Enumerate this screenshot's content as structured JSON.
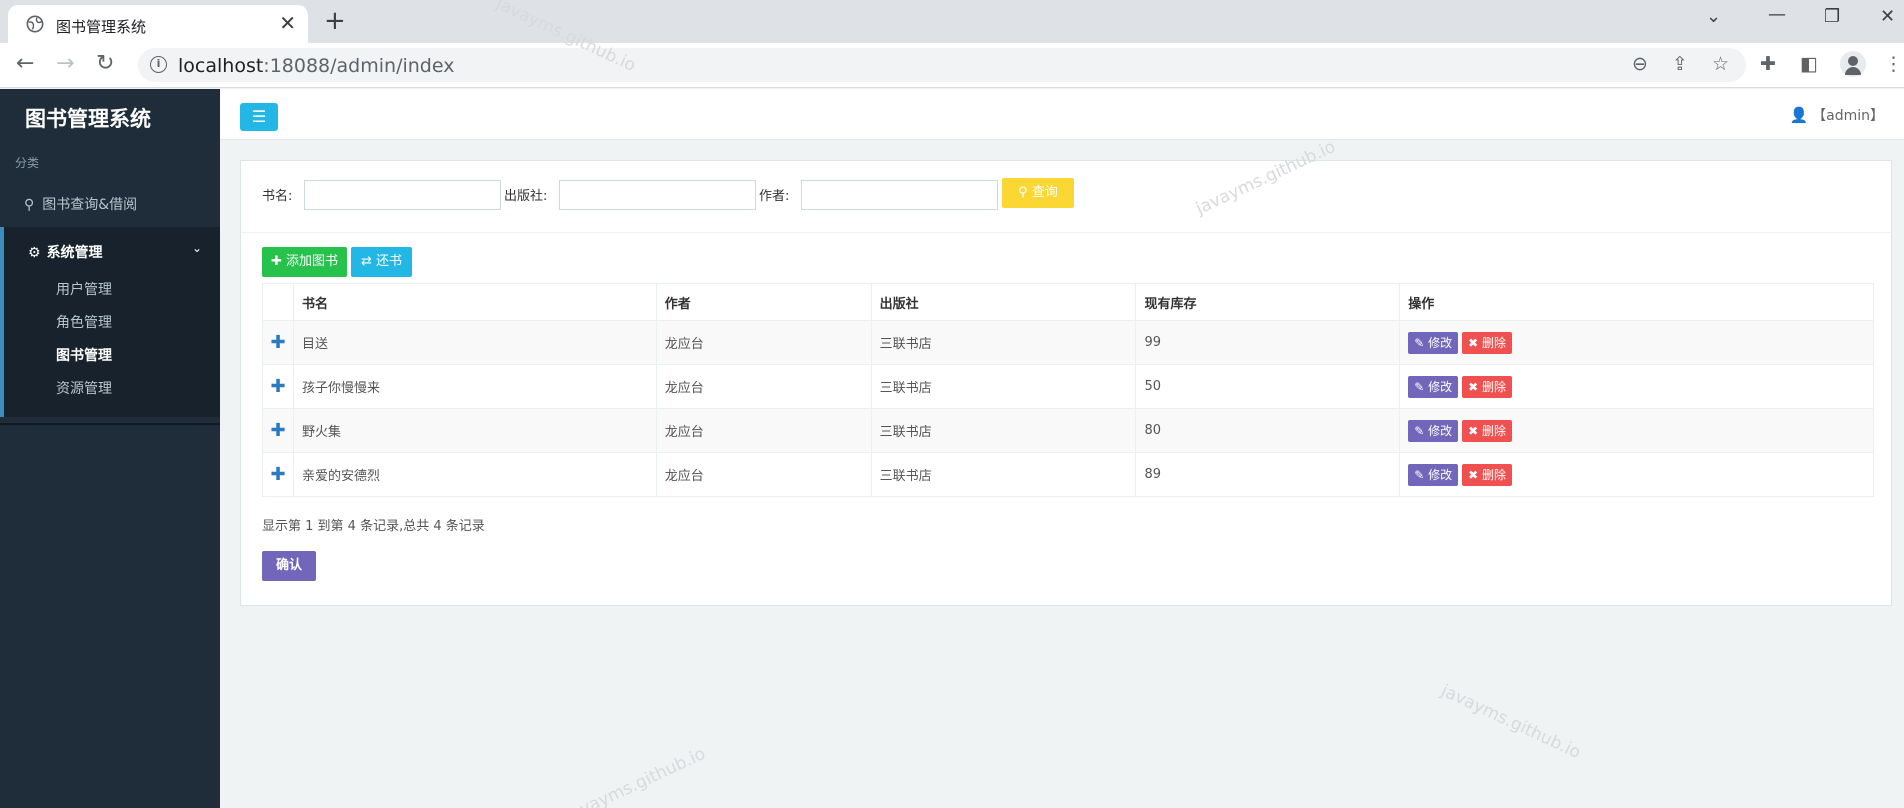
{
  "browser": {
    "tab_title": "图书管理系统",
    "url_host": "localhost",
    "url_rest": ":18088/admin/index"
  },
  "sidebar": {
    "brand": "图书管理系统",
    "category": "分类",
    "book_query": "图书查询&借阅",
    "system_group": "系统管理",
    "sub_items": [
      "用户管理",
      "角色管理",
      "图书管理",
      "资源管理"
    ],
    "active_sub": "图书管理"
  },
  "header": {
    "user": "【admin】"
  },
  "search": {
    "book_name_label": "书名:",
    "publisher_label": "出版社:",
    "author_label": "作者:",
    "book_name_value": "",
    "publisher_value": "",
    "author_value": "",
    "query_button": "查询"
  },
  "toolbar": {
    "add_book": "添加图书",
    "return_book": "还书"
  },
  "table": {
    "columns": [
      "书名",
      "作者",
      "出版社",
      "现有库存",
      "操作"
    ],
    "rows": [
      {
        "name": "目送",
        "author": "龙应台",
        "publisher": "三联书店",
        "stock": "99"
      },
      {
        "name": "孩子你慢慢来",
        "author": "龙应台",
        "publisher": "三联书店",
        "stock": "50"
      },
      {
        "name": "野火集",
        "author": "龙应台",
        "publisher": "三联书店",
        "stock": "80"
      },
      {
        "name": "亲爱的安德烈",
        "author": "龙应台",
        "publisher": "三联书店",
        "stock": "89"
      }
    ],
    "edit_label": "修改",
    "delete_label": "删除"
  },
  "pager": {
    "info": "显示第 1 到第 4 条记录,总共 4 条记录"
  },
  "confirm_button": "确认",
  "watermark": "javayms.github.io"
}
